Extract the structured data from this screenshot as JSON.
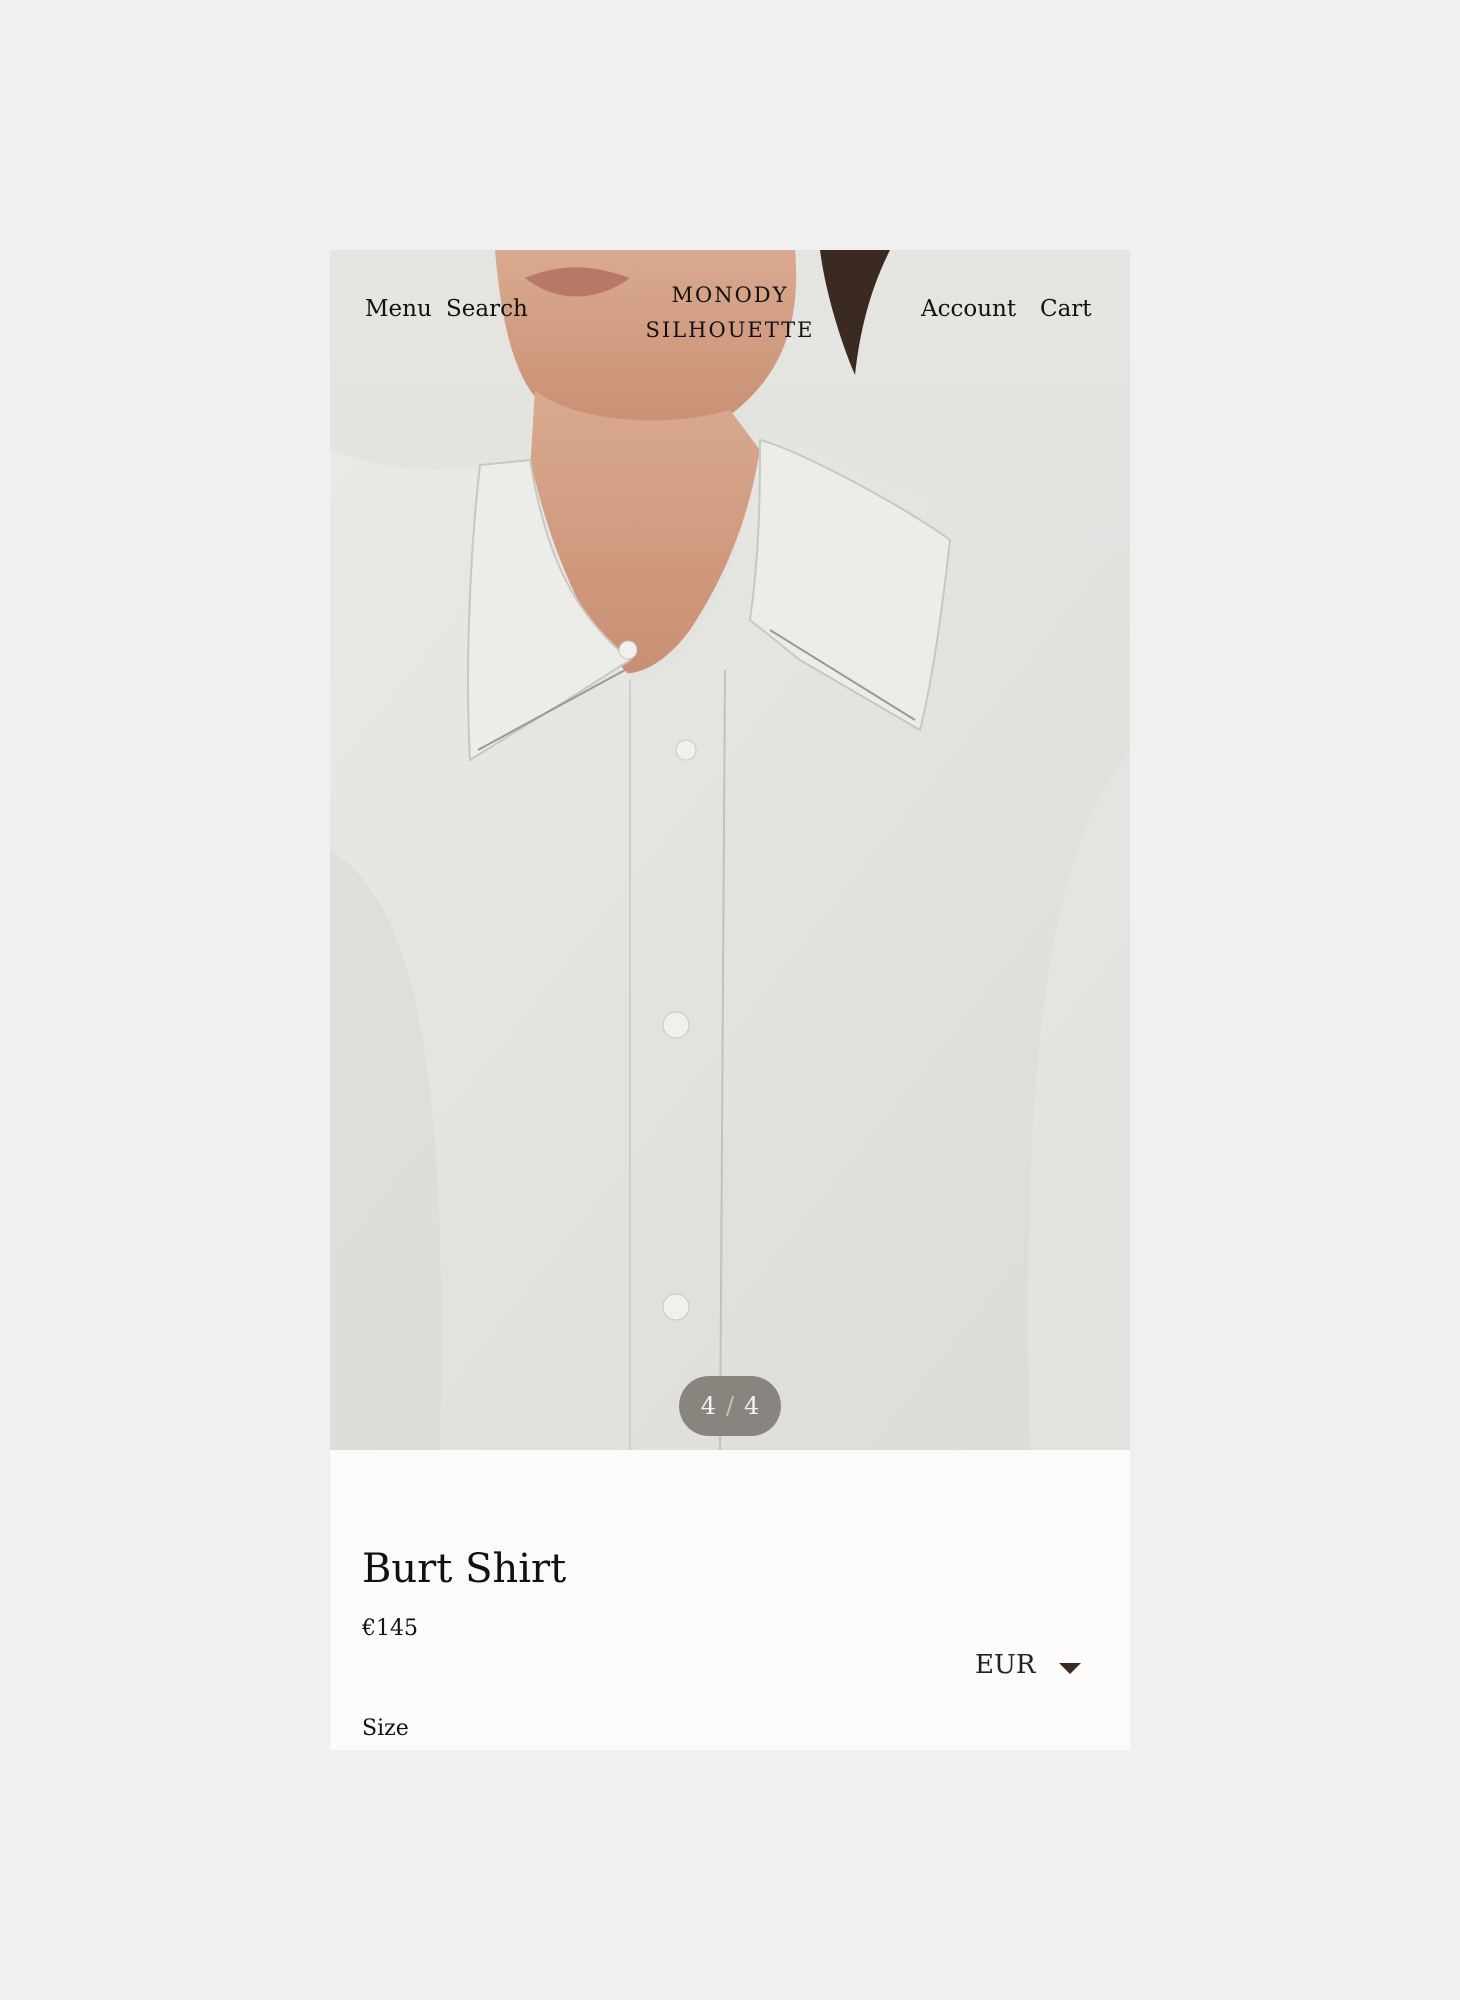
{
  "header": {
    "menu_label": "Menu",
    "search_label": "Search",
    "brand_line1": "MONODY",
    "brand_line2": "SILHOUETTE",
    "account_label": "Account",
    "cart_label": "Cart"
  },
  "gallery": {
    "current": "4",
    "separator": "/",
    "total": "4"
  },
  "product": {
    "title": "Burt Shirt",
    "price": "€145",
    "currency": "EUR",
    "size_label": "Size"
  }
}
